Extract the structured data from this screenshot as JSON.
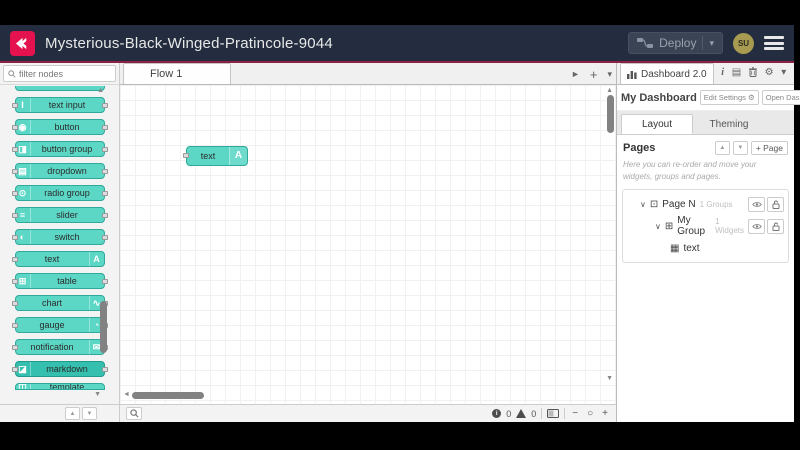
{
  "colors": {
    "header_bg": "#232d3f",
    "header_accent": "#8e2045",
    "logo_red": "#e4134f",
    "node_teal": "#5cd7c6",
    "node_teal_border": "#2fa99a",
    "node_dark_teal": "#35bfae",
    "avatar_bg": "#a89a50"
  },
  "header": {
    "title": "Mysterious-Black-Winged-Pratincole-9044",
    "deploy_label": "Deploy",
    "avatar_initials": "SU"
  },
  "palette": {
    "filter_placeholder": "filter nodes",
    "nodes": [
      {
        "id": "clipped-top",
        "label": "",
        "icon": "hidden",
        "icon_glyph": "",
        "icon_side": "left",
        "partial": "top"
      },
      {
        "id": "text-input",
        "label": "text input",
        "icon": "text-cursor-icon",
        "icon_glyph": "I",
        "icon_side": "left"
      },
      {
        "id": "button",
        "label": "button",
        "icon": "pointer-icon",
        "icon_glyph": "◉",
        "icon_side": "left"
      },
      {
        "id": "button-group",
        "label": "button group",
        "icon": "button-group-icon",
        "icon_glyph": "◨",
        "icon_side": "left"
      },
      {
        "id": "dropdown",
        "label": "dropdown",
        "icon": "dropdown-icon",
        "icon_glyph": "▤",
        "icon_side": "left"
      },
      {
        "id": "radio-group",
        "label": "radio group",
        "icon": "radio-icon",
        "icon_glyph": "⊙",
        "icon_side": "left"
      },
      {
        "id": "slider",
        "label": "slider",
        "icon": "slider-icon",
        "icon_glyph": "≡",
        "icon_side": "left"
      },
      {
        "id": "switch",
        "label": "switch",
        "icon": "switch-icon",
        "icon_glyph": "◐",
        "icon_side": "left"
      },
      {
        "id": "text",
        "label": "text",
        "icon": "text-icon",
        "icon_glyph": "A",
        "icon_side": "right",
        "ports": "left"
      },
      {
        "id": "table",
        "label": "table",
        "icon": "table-icon",
        "icon_glyph": "⊞",
        "icon_side": "left"
      },
      {
        "id": "chart",
        "label": "chart",
        "icon": "chart-icon",
        "icon_glyph": "∿",
        "icon_side": "right"
      },
      {
        "id": "gauge",
        "label": "gauge",
        "icon": "gauge-icon",
        "icon_glyph": "◔",
        "icon_side": "right"
      },
      {
        "id": "notification",
        "label": "notification",
        "icon": "notification-icon",
        "icon_glyph": "✉",
        "icon_side": "right"
      },
      {
        "id": "markdown",
        "label": "markdown",
        "icon": "markdown-icon",
        "icon_glyph": "◪",
        "icon_side": "left",
        "variant": "dark"
      },
      {
        "id": "template",
        "label": "template",
        "icon": "template-icon",
        "icon_glyph": "◫",
        "icon_side": "left",
        "partial": "bottom"
      }
    ]
  },
  "workspace": {
    "tab_label": "Flow 1",
    "canvas_node": {
      "label": "text",
      "icon_glyph": "A"
    },
    "status": {
      "info_count": "0",
      "warning_count": "0",
      "zoom_out": "−",
      "zoom_reset": "○",
      "zoom_in": "+"
    }
  },
  "sidebar": {
    "tab_label": "Dashboard 2.0",
    "dashboard_name": "My Dashboard",
    "edit_settings_label": "Edit Settings",
    "open_dashboard_label": "Open Dashboard",
    "layout_tab": "Layout",
    "theming_tab": "Theming",
    "pages_heading": "Pages",
    "add_page_label": "+ Page",
    "help_text": "Here you can re-order and move your widgets, groups and pages.",
    "tree": [
      {
        "label": "Page N",
        "meta": "1 Groups",
        "icon_glyph": "⊡",
        "depth": 1,
        "caret": true,
        "actions": true
      },
      {
        "label": "My Group",
        "meta": "1 Widgets",
        "icon_glyph": "⊞",
        "depth": 2,
        "caret": true,
        "actions": true
      },
      {
        "label": "text",
        "meta": "",
        "icon_glyph": "▦",
        "depth": 3,
        "caret": false,
        "actions": false
      }
    ]
  },
  "icons": {
    "caret_down": "▾",
    "tree_caret": "∨",
    "scroll_up": "▲",
    "scroll_down": "▼",
    "scroll_left": "◄",
    "tab_next": "►",
    "add": "+",
    "collapse_up": "▲",
    "collapse_down": "▼",
    "gear": "⚙",
    "external_link": "↗",
    "info": "i",
    "book": "▤"
  }
}
